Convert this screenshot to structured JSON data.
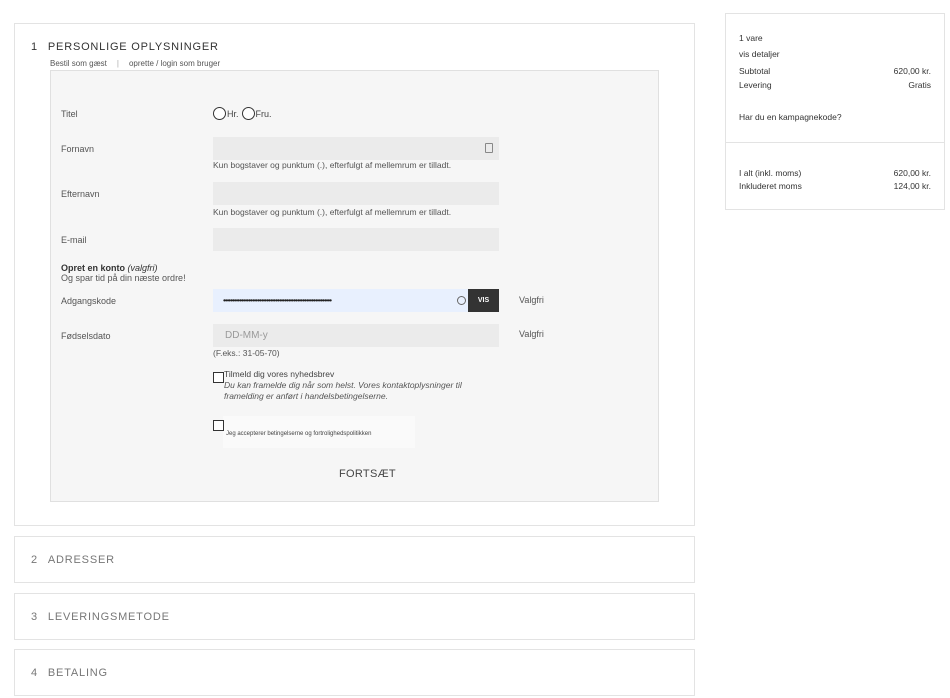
{
  "step1": {
    "number": "1",
    "title": "PERSONLIGE OPLYSNINGER",
    "guest_link": "Bestil som gæst",
    "separator": "|",
    "login_link": "oprette / login som bruger"
  },
  "form": {
    "title_label": "Titel",
    "title_options": [
      "Hr.",
      "Fru."
    ],
    "firstname_label": "Fornavn",
    "firstname_hint": "Kun bogstaver og punktum (.), efterfulgt af mellemrum er tilladt.",
    "lastname_label": "Efternavn",
    "lastname_hint": "Kun bogstaver og punktum (.), efterfulgt af mellemrum er tilladt.",
    "email_label": "E-mail",
    "account_title": "Opret en konto",
    "account_optional": "(valgfri)",
    "account_sub": "Og spar tid på din næste ordre!",
    "password_label": "Adgangskode",
    "password_value": "••••••••••••••••••••••••••••••••••••••••••••••••••••••••••••",
    "show_button": "VIS",
    "password_optional": "Valgfri",
    "birthdate_label": "Fødselsdato",
    "birthdate_placeholder": "DD-MM-y",
    "birthdate_optional": "Valgfri",
    "birthdate_example": "(F.eks.: 31-05-70)",
    "newsletter_label": "Tilmeld dig vores nyhedsbrev",
    "newsletter_desc": "Du kan framelde dig når som helst. Vores kontaktoplysninger til framelding er anført i handelsbetingelserne.",
    "terms_label": "Jeg accepterer betingelserne og fortrolighedspolitikken",
    "continue_button": "FORTSÆT"
  },
  "steps": [
    {
      "number": "2",
      "title": "ADRESSER"
    },
    {
      "number": "3",
      "title": "LEVERINGSMETODE"
    },
    {
      "number": "4",
      "title": "BETALING"
    }
  ],
  "summary": {
    "items_count": "1 vare",
    "details_link": "vis detaljer",
    "subtotal_label": "Subtotal",
    "subtotal_value": "620,00 kr.",
    "shipping_label": "Levering",
    "shipping_value": "Gratis",
    "promo_link": "Har du en kampagnekode?",
    "total_label": "I alt (inkl. moms)",
    "total_value": "620,00 kr.",
    "vat_label": "Inkluderet moms",
    "vat_value": "124,00 kr."
  }
}
